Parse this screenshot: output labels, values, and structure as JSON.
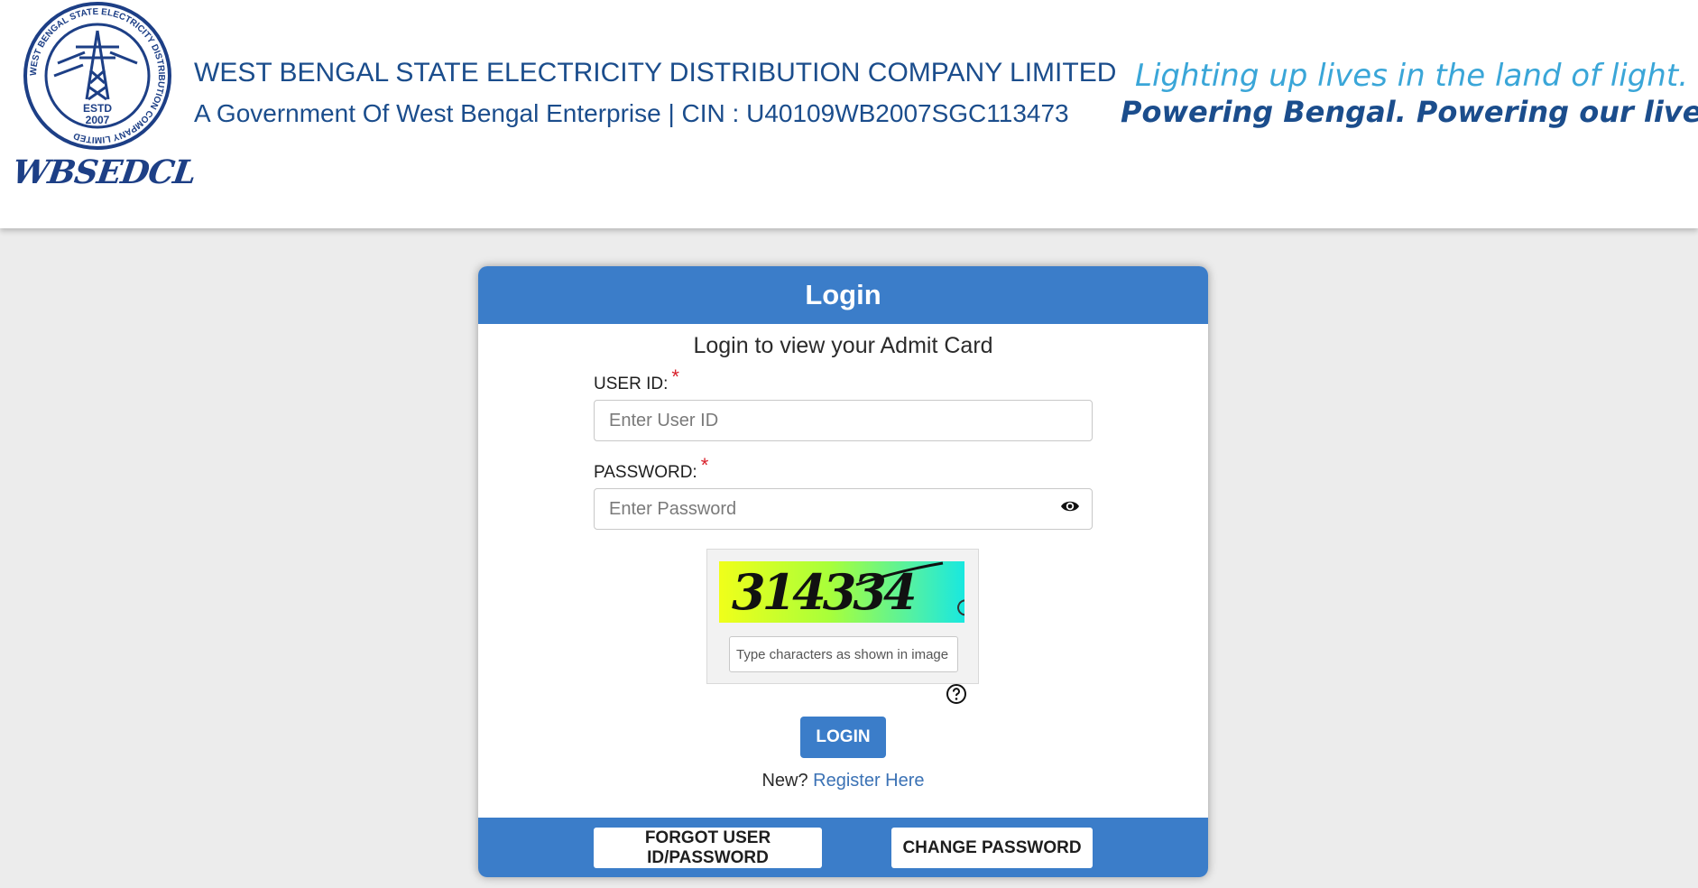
{
  "header": {
    "logo_wordmark": "WBSEDCL",
    "seal_text": {
      "ring": "WEST BENGAL STATE ELECTRICITY DISTRIBUTION COMPANY LIMITED",
      "estd": "ESTD",
      "year": "2007"
    },
    "company_name": "WEST BENGAL STATE ELECTRICITY DISTRIBUTION COMPANY LIMITED",
    "company_sub": "A Government Of West Bengal Enterprise | CIN : U40109WB2007SGC113473",
    "tagline_1": "Lighting up lives in the land of light.",
    "tagline_2": "Powering Bengal. Powering our lives..."
  },
  "login": {
    "title": "Login",
    "subtitle": "Login to view your Admit Card",
    "user_id": {
      "label": "USER ID:",
      "required_mark": "*",
      "placeholder": "Enter User ID",
      "value": ""
    },
    "password": {
      "label": "PASSWORD:",
      "required_mark": "*",
      "placeholder": "Enter Password",
      "value": ""
    },
    "captcha": {
      "image_text": "314334",
      "placeholder": "Type characters as shown in image",
      "value": ""
    },
    "login_button": "LOGIN",
    "register_prompt": "New?",
    "register_link": "Register Here",
    "footer": {
      "forgot_button": "FORGOT USER ID/PASSWORD",
      "change_button": "CHANGE PASSWORD"
    }
  },
  "colors": {
    "primary": "#3b7dc9",
    "heading_text": "#1b4d8c",
    "tagline_light": "#3aa6d8",
    "required": "#d8202a",
    "page_background": "#ececec"
  },
  "icons": [
    "seal-logo-icon",
    "eye-icon",
    "refresh-icon",
    "help-icon"
  ]
}
